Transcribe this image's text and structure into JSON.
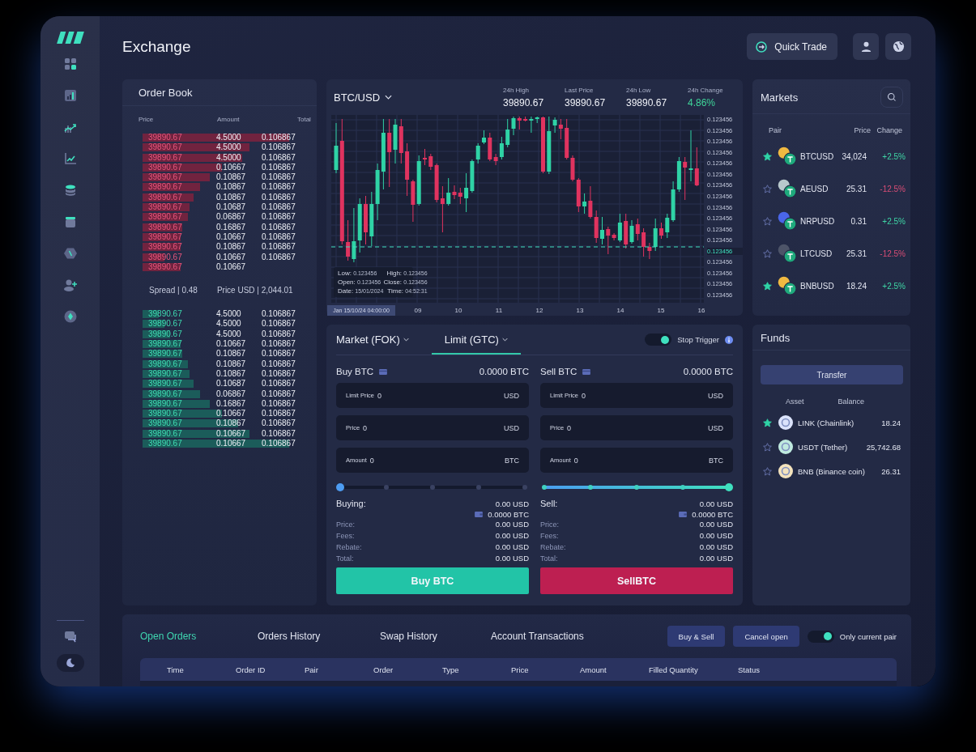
{
  "header": {
    "title": "Exchange",
    "quick_trade": "Quick Trade"
  },
  "order_book": {
    "title": "Order Book",
    "columns": [
      "Price",
      "Amount",
      "Total"
    ],
    "asks": [
      {
        "price": "39890.67",
        "amount": "4.5000",
        "total": "0.106867"
      },
      {
        "price": "39890.67",
        "amount": "4.5000",
        "total": "0.106867"
      },
      {
        "price": "39890.67",
        "amount": "4.5000",
        "total": "0.106867"
      },
      {
        "price": "39890.67",
        "amount": "0.10667",
        "total": "0.106867"
      },
      {
        "price": "39890.67",
        "amount": "0.10867",
        "total": "0.106867"
      },
      {
        "price": "39890.67",
        "amount": "0.10867",
        "total": "0.106867"
      },
      {
        "price": "39890.67",
        "amount": "0.10867",
        "total": "0.106867"
      },
      {
        "price": "39890.67",
        "amount": "0.10687",
        "total": "0.106867"
      },
      {
        "price": "39890.67",
        "amount": "0.06867",
        "total": "0.106867"
      },
      {
        "price": "39890.67",
        "amount": "0.16867",
        "total": "0.106867"
      },
      {
        "price": "39890.67",
        "amount": "0.10667",
        "total": "0.106867"
      },
      {
        "price": "39890.67",
        "amount": "0.10867",
        "total": "0.106867"
      },
      {
        "price": "39890.67",
        "amount": "0.10667",
        "total": "0.106867"
      },
      {
        "price": "39890.67",
        "amount": "0.10667"
      }
    ],
    "spread": "Spread | 0.48",
    "price_usd": "Price USD | 2,044.01",
    "bids": [
      {
        "price": "39890.67",
        "amount": "4.5000",
        "total": "0.106867"
      },
      {
        "price": "39890.67",
        "amount": "4.5000",
        "total": "0.106867"
      },
      {
        "price": "39890.67",
        "amount": "4.5000",
        "total": "0.106867"
      },
      {
        "price": "39890.67",
        "amount": "0.10667",
        "total": "0.106867"
      },
      {
        "price": "39890.67",
        "amount": "0.10867",
        "total": "0.106867"
      },
      {
        "price": "39890.67",
        "amount": "0.10867",
        "total": "0.106867"
      },
      {
        "price": "39890.67",
        "amount": "0.10867",
        "total": "0.106867"
      },
      {
        "price": "39890.67",
        "amount": "0.10687",
        "total": "0.106867"
      },
      {
        "price": "39890.67",
        "amount": "0.06867",
        "total": "0.106867"
      },
      {
        "price": "39890.67",
        "amount": "0.16867",
        "total": "0.106867"
      },
      {
        "price": "39890.67",
        "amount": "0.10667",
        "total": "0.106867"
      },
      {
        "price": "39890.67",
        "amount": "0.10867",
        "total": "0.106867"
      },
      {
        "price": "39890.67",
        "amount": "0.10667",
        "total": "0.106867"
      },
      {
        "price": "39890.67",
        "amount": "0.10667",
        "total": "0.106867"
      }
    ]
  },
  "chart": {
    "pair": "BTC/USD",
    "stats": [
      {
        "label": "24h High",
        "value": "39890.67",
        "kind": "plain"
      },
      {
        "label": "Last Price",
        "value": "39890.67",
        "kind": "plain"
      },
      {
        "label": "24h Low",
        "value": "39890.67",
        "kind": "plain"
      },
      {
        "label": "24h Change",
        "value": "4.86%",
        "kind": "change"
      }
    ],
    "y_labels": [
      {
        "text": "0.123456",
        "kind": "tick"
      },
      {
        "text": "0.123456",
        "kind": "tick"
      },
      {
        "text": "0.123456",
        "kind": "tick"
      },
      {
        "text": "0.123456",
        "kind": "tick"
      },
      {
        "text": "0.123456",
        "kind": "tick"
      },
      {
        "text": "0.123456",
        "kind": "tick"
      },
      {
        "text": "0.123456",
        "kind": "tick"
      },
      {
        "text": "0.123456",
        "kind": "tick"
      },
      {
        "text": "0.123456",
        "kind": "tick"
      },
      {
        "text": "0.123456",
        "kind": "tick"
      },
      {
        "text": "0.123456",
        "kind": "tick"
      },
      {
        "text": "0.123456",
        "kind": "tick"
      },
      {
        "text": "0.123456",
        "kind": "current"
      },
      {
        "text": "0.123456",
        "kind": "tick"
      },
      {
        "text": "0.123456",
        "kind": "tick"
      },
      {
        "text": "0.123456",
        "kind": "tick"
      },
      {
        "text": "0.123456",
        "kind": "tick"
      }
    ],
    "cursor_time": "Jan 15/10/24 04:00:00",
    "x_labels": [
      "09",
      "10",
      "11",
      "12",
      "13",
      "14",
      "15",
      "16"
    ],
    "tooltip": [
      {
        "label": "Low:",
        "value": "0.123456"
      },
      {
        "label": "High:",
        "value": "0.123456"
      },
      {
        "label": "Open:",
        "value": "0.123456"
      },
      {
        "label": "Close:",
        "value": "0.123456"
      },
      {
        "label": "Date:",
        "value": "15/01/2024"
      },
      {
        "label": "Time:",
        "value": "04:52:31"
      }
    ]
  },
  "trade": {
    "tabs": [
      {
        "label": "Market (FOK)",
        "selected": false
      },
      {
        "label": "Limit (GTC)",
        "selected": true
      }
    ],
    "stop_trigger": {
      "label": "Stop Trigger",
      "on": true
    },
    "sides": [
      {
        "kind": "buy",
        "title": "Buy BTC",
        "balance": "0.0000 BTC",
        "fields": [
          {
            "label": "Limit Price",
            "value": "0",
            "unit": "USD"
          },
          {
            "label": "Price",
            "value": "0",
            "unit": "USD"
          },
          {
            "label": "Amount",
            "value": "0",
            "unit": "BTC"
          }
        ],
        "level": 0,
        "summary_title": "Buying:",
        "summary_total": "0.00 USD",
        "wallet": "0.0000 BTC",
        "details": [
          {
            "label": "Price:",
            "value": "0.00 USD"
          },
          {
            "label": "Fees:",
            "value": "0.00 USD"
          },
          {
            "label": "Rebate:",
            "value": "0.00 USD"
          },
          {
            "label": "Total:",
            "value": "0.00 USD"
          }
        ],
        "button": "Buy BTC"
      },
      {
        "kind": "sell",
        "title": "Sell BTC",
        "balance": "0.0000 BTC",
        "fields": [
          {
            "label": "Limit Price",
            "value": "0",
            "unit": "USD"
          },
          {
            "label": "Price",
            "value": "0",
            "unit": "USD"
          },
          {
            "label": "Amount",
            "value": "0",
            "unit": "BTC"
          }
        ],
        "level": 1,
        "summary_title": "Sell:",
        "summary_total": "0.00 USD",
        "wallet": "0.0000 BTC",
        "details": [
          {
            "label": "Price:",
            "value": "0.00 USD"
          },
          {
            "label": "Fees:",
            "value": "0.00 USD"
          },
          {
            "label": "Rebate:",
            "value": "0.00 USD"
          },
          {
            "label": "Total:",
            "value": "0.00 USD"
          }
        ],
        "button": "SellBTC"
      }
    ]
  },
  "markets": {
    "title": "Markets",
    "columns": [
      "Pair",
      "Price",
      "Change"
    ],
    "rows": [
      {
        "favorite": true,
        "color": "#f0b941",
        "pair": "BTCUSD",
        "price": "34,024",
        "change": {
          "text": "+2.5%",
          "color": "#3fd6a6"
        }
      },
      {
        "favorite": false,
        "color": "#b8c8cc",
        "pair": "AEUSD",
        "price": "25.31",
        "change": {
          "text": "-12.5%",
          "color": "#d94d76"
        }
      },
      {
        "favorite": false,
        "color": "#4a66e8",
        "pair": "NRPUSD",
        "price": "0.31",
        "change": {
          "text": "+2.5%",
          "color": "#3fd6a6"
        }
      },
      {
        "favorite": false,
        "color": "#4d5468",
        "pair": "LTCUSD",
        "price": "25.31",
        "change": {
          "text": "-12.5%",
          "color": "#d94d76"
        }
      },
      {
        "favorite": true,
        "color": "#f0b941",
        "pair": "BNBUSD",
        "price": "18.24",
        "change": {
          "text": "+2.5%",
          "color": "#3fd6a6"
        }
      }
    ]
  },
  "funds": {
    "title": "Funds",
    "transfer": "Transfer",
    "columns": [
      "Asset",
      "Balance"
    ],
    "rows": [
      {
        "favorite": true,
        "color": "#dbe3fb",
        "asset": "LINK (Chainlink)",
        "balance": "18.24"
      },
      {
        "favorite": false,
        "color": "#bfeadf",
        "asset": "USDT (Tether)",
        "balance": "25,742.68"
      },
      {
        "favorite": false,
        "color": "#f4e3bd",
        "asset": "BNB (Binance coin)",
        "balance": "26.31"
      }
    ]
  },
  "orders": {
    "tabs": [
      {
        "label": "Open Orders",
        "selected": true
      },
      {
        "label": "Orders History",
        "selected": false
      },
      {
        "label": "Swap History",
        "selected": false
      },
      {
        "label": "Account Transactions",
        "selected": false
      }
    ],
    "buttons": [
      "Buy & Sell",
      "Cancel open"
    ],
    "only_current_pair": {
      "label": "Only current pair",
      "on": true
    },
    "columns": [
      "Time",
      "Order ID",
      "Pair",
      "Order",
      "Type",
      "Price",
      "Amount",
      "Filled Quantity",
      "Status"
    ]
  }
}
